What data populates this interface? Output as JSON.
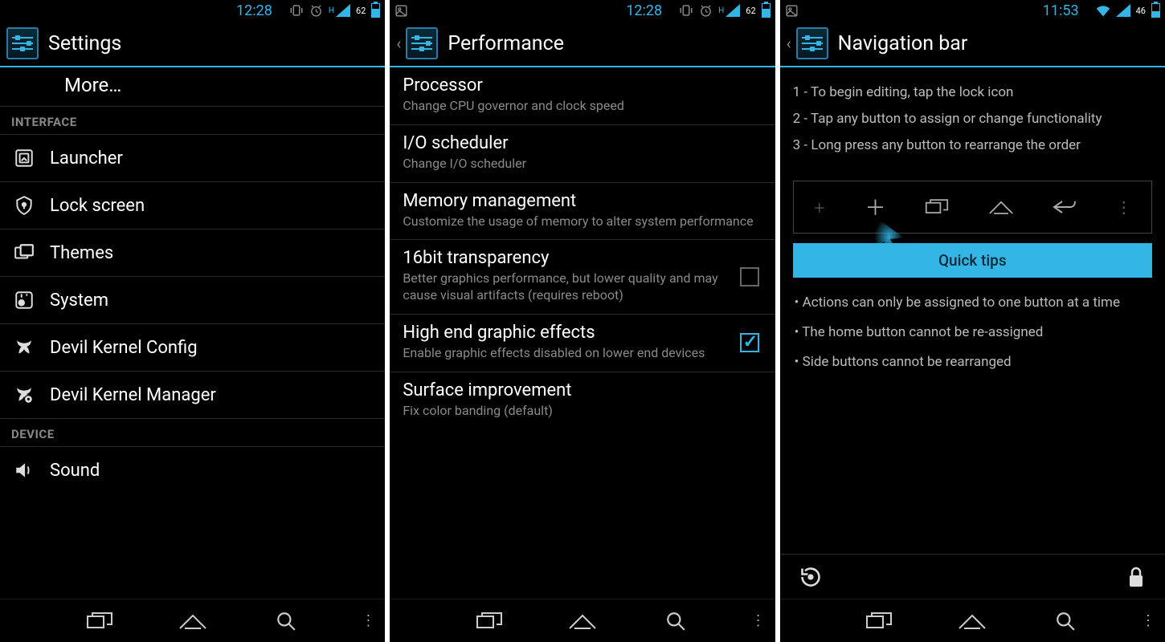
{
  "accent": "#33b5e5",
  "screens": [
    {
      "status": {
        "time": "12:28",
        "battery": "62",
        "signal_label": "H",
        "has_caret": false,
        "has_wifi": false,
        "has_pic": false
      },
      "title": "Settings",
      "more": "More…",
      "cat1": "INTERFACE",
      "items1": [
        {
          "icon": "launcher",
          "label": "Launcher"
        },
        {
          "icon": "lock",
          "label": "Lock screen"
        },
        {
          "icon": "themes",
          "label": "Themes"
        },
        {
          "icon": "system",
          "label": "System"
        },
        {
          "icon": "devil",
          "label": "Devil Kernel Config"
        },
        {
          "icon": "devilmgr",
          "label": "Devil Kernel Manager"
        }
      ],
      "cat2": "DEVICE",
      "items2": [
        {
          "icon": "sound",
          "label": "Sound"
        }
      ]
    },
    {
      "status": {
        "time": "12:28",
        "battery": "62",
        "signal_label": "H",
        "has_caret": true,
        "has_wifi": false,
        "has_pic": true
      },
      "title": "Performance",
      "rows": [
        {
          "title": "Processor",
          "sub": "Change CPU governor and clock speed",
          "check": null
        },
        {
          "title": "I/O scheduler",
          "sub": "Change I/O scheduler",
          "check": null
        },
        {
          "title": "Memory management",
          "sub": "Customize the usage of memory to alter system performance",
          "check": null
        },
        {
          "title": "16bit transparency",
          "sub": "Better graphics performance, but lower quality and may cause visual artifacts (requires reboot)",
          "check": false
        },
        {
          "title": "High end graphic effects",
          "sub": "Enable graphic effects disabled on lower end devices",
          "check": true
        },
        {
          "title": "Surface improvement",
          "sub": "Fix color banding (default)",
          "check": null
        }
      ]
    },
    {
      "status": {
        "time": "11:53",
        "battery": "46",
        "signal_label": "",
        "has_caret": true,
        "has_wifi": true,
        "has_pic": true
      },
      "title": "Navigation bar",
      "instructions": [
        "1 - To begin editing, tap the lock icon",
        "2 - Tap any button to assign or change functionality",
        "3 - Long press any button to rearrange the order"
      ],
      "quicktips": "Quick tips",
      "bullets": [
        "• Actions can only be assigned to one button at a time",
        "• The home button cannot be re-assigned",
        "• Side buttons cannot be rearranged"
      ]
    }
  ]
}
